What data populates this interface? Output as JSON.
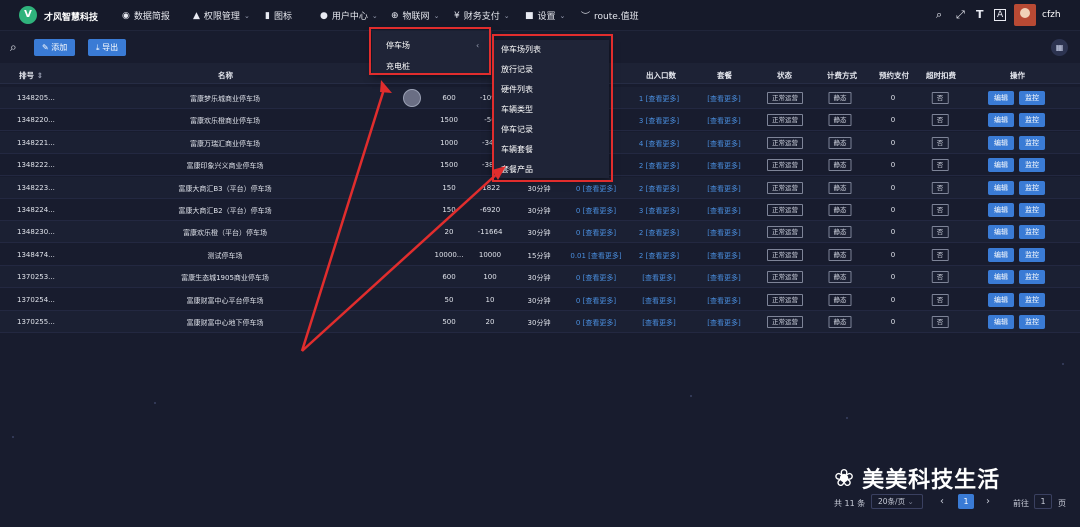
{
  "app": {
    "logo": "V",
    "name": "才风智慧科技"
  },
  "nav": [
    {
      "icon": "dashboard-icon",
      "glyph": "◉",
      "label": "数据简报",
      "caret": false
    },
    {
      "icon": "lock-icon",
      "glyph": "▲",
      "label": "权限管理",
      "caret": true
    },
    {
      "icon": "chart-icon",
      "glyph": "▮",
      "label": "图标",
      "caret": false
    },
    {
      "icon": "user-icon",
      "glyph": "●",
      "label": "用户中心",
      "caret": true
    },
    {
      "icon": "iot-icon",
      "glyph": "⊕",
      "label": "物联网",
      "caret": true
    },
    {
      "icon": "finance-icon",
      "glyph": "¥",
      "label": "财务支付",
      "caret": true
    },
    {
      "icon": "settings-icon",
      "glyph": "■",
      "label": "设置",
      "caret": true
    },
    {
      "icon": "route-icon",
      "glyph": "︶",
      "label": "route.值班",
      "caret": false
    }
  ],
  "header_right": {
    "username": "cfzh"
  },
  "toolbar": {
    "add_label": "添加",
    "export_label": "导出"
  },
  "table": {
    "headers": [
      "排号",
      "名称",
      "出入口数",
      "套餐",
      "状态",
      "计费方式",
      "预约支付",
      "超时扣费",
      "操作"
    ],
    "rows": [
      {
        "id": "1348205...",
        "name": "富康梦乐城商业停车场",
        "a": "600",
        "b": "-1097",
        "c": "",
        "d": "",
        "io": "1 [查看更多]",
        "pkg": "[查看更多]",
        "status": "正常运营",
        "billing": "静态",
        "prepay": "0",
        "overtime": "否"
      },
      {
        "id": "1348220...",
        "name": "富康欢乐橙商业停车场",
        "a": "1500",
        "b": "-56",
        "c": "",
        "d": "",
        "io": "3 [查看更多]",
        "pkg": "[查看更多]",
        "status": "正常运营",
        "billing": "静态",
        "prepay": "0",
        "overtime": "否"
      },
      {
        "id": "1348221...",
        "name": "富康万瑞汇商业停车场",
        "a": "1000",
        "b": "-346",
        "c": "",
        "d": "",
        "io": "4 [查看更多]",
        "pkg": "[查看更多]",
        "status": "正常运营",
        "billing": "静态",
        "prepay": "0",
        "overtime": "否"
      },
      {
        "id": "1348222...",
        "name": "富康印象兴义商业停车场",
        "a": "1500",
        "b": "-380",
        "c": "",
        "d": "",
        "io": "2 [查看更多]",
        "pkg": "[查看更多]",
        "status": "正常运营",
        "billing": "静态",
        "prepay": "0",
        "overtime": "否"
      },
      {
        "id": "1348223...",
        "name": "富康大商汇B3（平台）停车场",
        "a": "150",
        "b": "-1822",
        "c": "30分钟",
        "d": "0 [查看更多]",
        "io": "2 [查看更多]",
        "pkg": "[查看更多]",
        "status": "正常运营",
        "billing": "静态",
        "prepay": "0",
        "overtime": "否"
      },
      {
        "id": "1348224...",
        "name": "富康大商汇B2（平台）停车场",
        "a": "150",
        "b": "-6920",
        "c": "30分钟",
        "d": "0 [查看更多]",
        "io": "3 [查看更多]",
        "pkg": "[查看更多]",
        "status": "正常运营",
        "billing": "静态",
        "prepay": "0",
        "overtime": "否"
      },
      {
        "id": "1348230...",
        "name": "富康欢乐橙（平台）停车场",
        "a": "20",
        "b": "-11664",
        "c": "30分钟",
        "d": "0 [查看更多]",
        "io": "2 [查看更多]",
        "pkg": "[查看更多]",
        "status": "正常运营",
        "billing": "静态",
        "prepay": "0",
        "overtime": "否"
      },
      {
        "id": "1348474...",
        "name": "测试停车场",
        "a": "10000...",
        "b": "10000",
        "c": "15分钟",
        "d": "0.01 [查看更多]",
        "io": "2 [查看更多]",
        "pkg": "[查看更多]",
        "status": "正常运营",
        "billing": "静态",
        "prepay": "0",
        "overtime": "否"
      },
      {
        "id": "1370253...",
        "name": "富康生态城1905商业停车场",
        "a": "600",
        "b": "100",
        "c": "30分钟",
        "d": "0 [查看更多]",
        "io": "[查看更多]",
        "pkg": "[查看更多]",
        "status": "正常运营",
        "billing": "静态",
        "prepay": "0",
        "overtime": "否"
      },
      {
        "id": "1370254...",
        "name": "富康财富中心平台停车场",
        "a": "50",
        "b": "10",
        "c": "30分钟",
        "d": "0 [查看更多]",
        "io": "[查看更多]",
        "pkg": "[查看更多]",
        "status": "正常运营",
        "billing": "静态",
        "prepay": "0",
        "overtime": "否"
      },
      {
        "id": "1370255...",
        "name": "富康财富中心地下停车场",
        "a": "500",
        "b": "20",
        "c": "30分钟",
        "d": "0 [查看更多]",
        "io": "[查看更多]",
        "pkg": "[查看更多]",
        "status": "正常运营",
        "billing": "静态",
        "prepay": "0",
        "overtime": "否"
      }
    ],
    "edit_label": "编辑",
    "monitor_label": "监控"
  },
  "dropdown": {
    "level1": [
      "停车场",
      "充电桩"
    ],
    "level2": [
      "停车场列表",
      "放行记录",
      "硬件列表",
      "车辆类型",
      "停车记录",
      "车辆套餐",
      "套餐产品"
    ]
  },
  "pagination": {
    "total": "共 11 条",
    "page_size": "20条/页",
    "current_page": "1",
    "goto_label": "前往",
    "goto_value": "1",
    "page_suffix": "页"
  },
  "watermark": {
    "text": "美美科技生活"
  },
  "colors": {
    "background": "#181c2e",
    "accent": "#3a7bd5",
    "annotation": "#e12d2d",
    "brand": "#2fb37c"
  }
}
